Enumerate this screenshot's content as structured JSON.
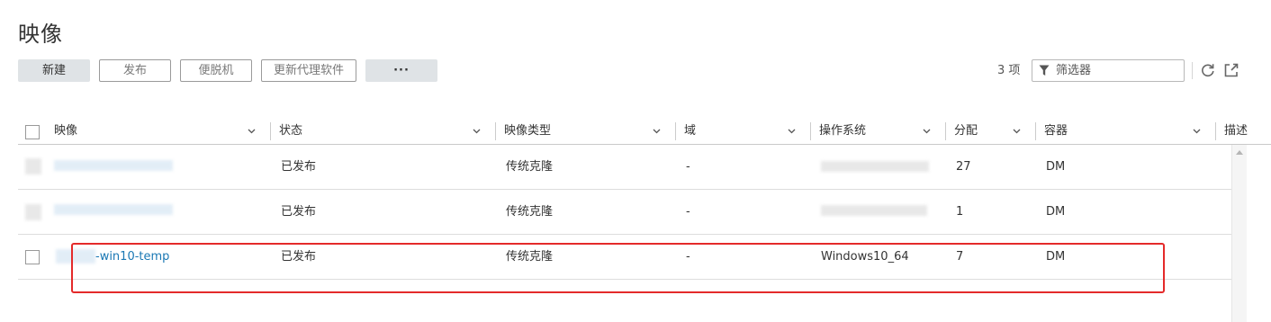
{
  "page": {
    "title": "映像"
  },
  "toolbar": {
    "new_label": "新建",
    "publish_label": "发布",
    "offline_label": "便脱机",
    "update_agent_label": "更新代理软件",
    "more_label": "···"
  },
  "tools": {
    "count_text": "3 项",
    "filter_placeholder": "筛选器",
    "icons": [
      "filter-icon",
      "refresh-icon",
      "export-icon"
    ]
  },
  "table": {
    "columns": [
      "映像",
      "状态",
      "映像类型",
      "域",
      "操作系统",
      "分配",
      "容器",
      "描述"
    ],
    "rows": [
      {
        "name": "",
        "status": "已发布",
        "type": "传统克隆",
        "domain": "-",
        "os": "",
        "assigned": "27",
        "container": "DM"
      },
      {
        "name": "",
        "status": "已发布",
        "type": "传统克隆",
        "domain": "-",
        "os": "",
        "assigned": "1",
        "container": "DM"
      },
      {
        "name": "-win10-temp",
        "status": "已发布",
        "type": "传统克隆",
        "domain": "-",
        "os": "Windows10_64",
        "assigned": "7",
        "container": "DM"
      }
    ]
  },
  "colors": {
    "link": "#1a78b4",
    "highlight": "#e42a2a",
    "primary_button": "#dfe3e6"
  }
}
